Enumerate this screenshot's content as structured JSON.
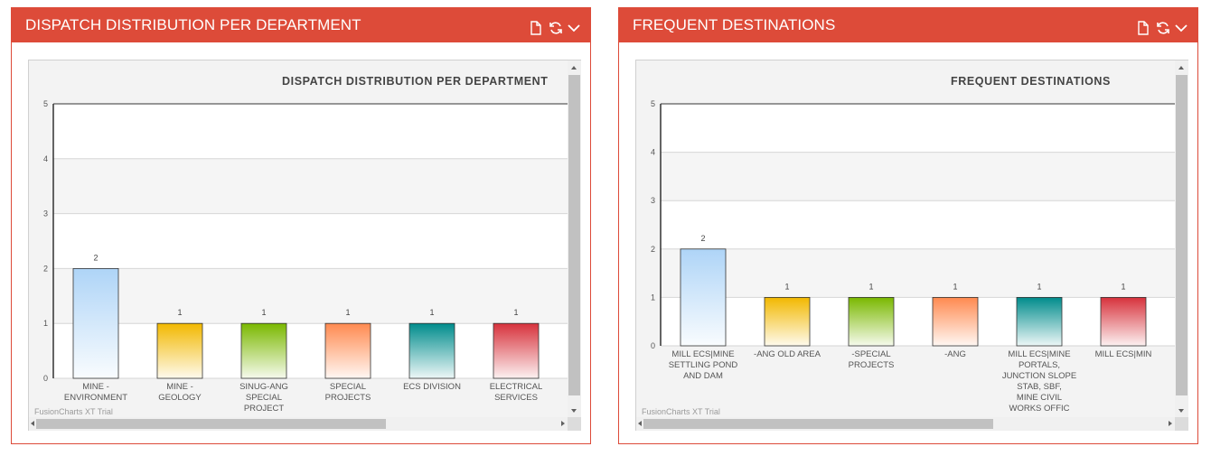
{
  "panels": [
    {
      "title": "DISPATCH DISTRIBUTION PER DEPARTMENT",
      "watermark": "FusionCharts XT Trial",
      "icons": [
        "document-icon",
        "refresh-icon",
        "chevron-down-icon"
      ]
    },
    {
      "title": "FREQUENT DESTINATIONS",
      "watermark": "FusionCharts XT Trial",
      "icons": [
        "document-icon",
        "refresh-icon",
        "chevron-down-icon"
      ]
    }
  ],
  "chart_data": [
    {
      "type": "bar",
      "title": "DISPATCH DISTRIBUTION PER DEPARTMENT",
      "categories": [
        "MINE - ENVIRONMENT",
        "MINE - GEOLOGY",
        "SINUG-ANG SPECIAL PROJECT",
        "SPECIAL PROJECTS",
        "ECS DIVISION",
        "ELECTRICAL SERVICES"
      ],
      "values": [
        2,
        1,
        1,
        1,
        1,
        1
      ],
      "ylim": [
        0,
        5
      ],
      "yticks": [
        0,
        1,
        2,
        3,
        4,
        5
      ],
      "grid": true,
      "bar_colors": [
        "#aed4f7",
        "#f2b800",
        "#7ab800",
        "#ff8a50",
        "#008c8c",
        "#d7323c"
      ]
    },
    {
      "type": "bar",
      "title": "FREQUENT DESTINATIONS",
      "categories": [
        "MILL ECS|MINE SETTLING POND AND DAM",
        "-ANG OLD AREA",
        "-SPECIAL PROJECTS",
        "-ANG",
        "MILL ECS|MINE PORTALS, JUNCTION SLOPE STAB, SBF, MINE CIVIL WORKS OFFIC",
        "MILL ECS|MIN"
      ],
      "values": [
        2,
        1,
        1,
        1,
        1,
        1
      ],
      "ylim": [
        0,
        5
      ],
      "yticks": [
        0,
        1,
        2,
        3,
        4,
        5
      ],
      "grid": true,
      "bar_colors": [
        "#aed4f7",
        "#f2b800",
        "#7ab800",
        "#ff8a50",
        "#008c8c",
        "#d7323c"
      ]
    }
  ]
}
